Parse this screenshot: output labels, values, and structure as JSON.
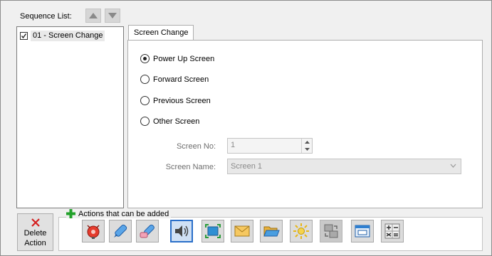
{
  "sequence": {
    "label": "Sequence List:",
    "items": [
      {
        "label": "01 - Screen Change",
        "checked": true
      }
    ]
  },
  "tab": {
    "label": "Screen Change"
  },
  "screen_options": [
    {
      "label": "Power Up Screen",
      "selected": true
    },
    {
      "label": "Forward Screen",
      "selected": false
    },
    {
      "label": "Previous Screen",
      "selected": false
    },
    {
      "label": "Other Screen",
      "selected": false
    }
  ],
  "screen_no": {
    "label": "Screen No:",
    "value": "1"
  },
  "screen_name": {
    "label": "Screen Name:",
    "value": "Screen 1"
  },
  "delete_action": {
    "line1": "Delete",
    "line2": "Action"
  },
  "actions": {
    "title": "Actions that can be added",
    "buttons": [
      {
        "icon": "alarm-bell-icon"
      },
      {
        "icon": "write-pen-icon"
      },
      {
        "icon": "erase-pen-icon"
      },
      {
        "icon": "speaker-icon",
        "selected": true
      },
      {
        "icon": "screen-capture-icon"
      },
      {
        "icon": "envelope-icon"
      },
      {
        "icon": "open-folder-icon"
      },
      {
        "icon": "brightness-icon"
      },
      {
        "icon": "window-switch-icon",
        "disabled": true
      },
      {
        "icon": "popup-window-icon"
      },
      {
        "icon": "calculator-icon"
      }
    ]
  },
  "colors": {
    "accent_green": "#22a12a",
    "delete_red": "#d42020",
    "selection_blue": "#2a6fc9"
  }
}
